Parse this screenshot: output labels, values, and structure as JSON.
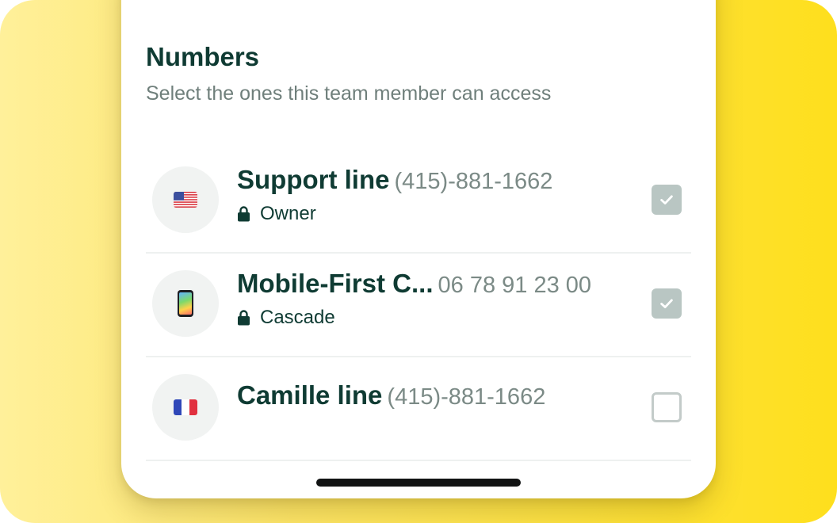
{
  "section": {
    "title": "Numbers",
    "subtitle": "Select the ones this team member can access"
  },
  "lines": [
    {
      "name": "Support line",
      "number": "(415)-881-1662",
      "owner": "Owner",
      "icon": "us-flag-icon",
      "checked": true
    },
    {
      "name": "Mobile-First C...",
      "number": "06 78 91 23 00",
      "owner": "Cascade",
      "icon": "mobile-phone-icon",
      "checked": true
    },
    {
      "name": "Camille line",
      "number": "(415)-881-1662",
      "owner": "",
      "icon": "france-flag-icon",
      "checked": false
    }
  ],
  "colors": {
    "text_primary": "#0f3b33",
    "text_secondary": "#6f7f7b",
    "checkbox_checked": "#b9c6c3",
    "background_yellow": "#fedf1d"
  }
}
